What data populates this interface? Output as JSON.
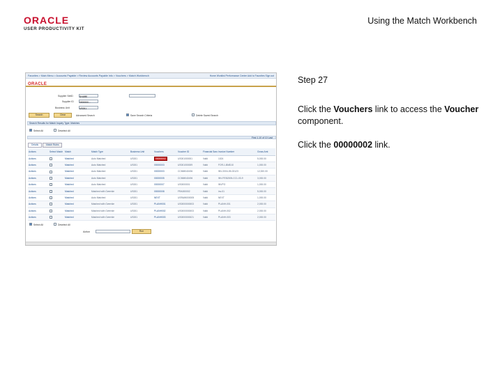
{
  "header": {
    "logo_brand": "ORACLE",
    "logo_subtitle": "USER PRODUCTIVITY KIT",
    "title": "Using the Match Workbench"
  },
  "instructions": {
    "step": "Step 27",
    "line1_pre": "Click the ",
    "line1_bold1": "Vouchers",
    "line1_mid": " link to access the ",
    "line1_bold2": "Voucher",
    "line1_post": " component.",
    "line2_pre": "Click the ",
    "line2_bold": "00000002",
    "line2_post": " link."
  },
  "screenshot": {
    "crumbs": "Favorites > Main Menu > Accounts Payable > Review Accounts Payable Info > Vouchers > Match Workbench",
    "navlinks": "Home   Worklist   Performance Center   Add to Favorites   Sign out",
    "oracle": "ORACLE",
    "fields": {
      "supplier_setid_label": "Supplier SetID",
      "supplier_setid_value": "SHARE",
      "supplier_id_label": "Supplier ID",
      "supplier_id_value": "0000000...",
      "match_rule_label": "Business Unit",
      "match_rule_value": "US001"
    },
    "buttons": {
      "search": "Search",
      "clear": "Clear",
      "continue": "Continue",
      "run": "Run"
    },
    "options": {
      "advanced_search": "Advanced Search",
      "save_search_criteria": "Save Search Criteria",
      "delete_saved_search": "Delete Saved Search"
    },
    "section_title": "Search Results for Match Inquiry Type: Matches",
    "select_all": "Select All",
    "deselect_all": "Deselect All",
    "tabs": [
      "Details",
      "Match Rules"
    ],
    "pager": "First  1-10 of 10  Last",
    "columns": [
      "Actions",
      "Select Match",
      "Match",
      "Match Type",
      "Business Unit",
      "Vouchers",
      "Voucher ID",
      "Financial Sanctions Status",
      "Invoice Number",
      "Gross Amt"
    ],
    "rows": [
      [
        "Actions",
        "",
        "Matched",
        "Auto Matched",
        "US001",
        "00000002",
        "US001000001",
        "Valid",
        "1024",
        "5,000.00"
      ],
      [
        "Actions",
        "",
        "Matched",
        "Auto Matched",
        "US001",
        "00000003",
        "US001000009",
        "Valid",
        "FOR-1-BMD10",
        "1,000.00"
      ],
      [
        "Actions",
        "",
        "Matched",
        "Auto Matched",
        "US001",
        "00000003",
        "CCMM040494",
        "Valid",
        "INV-2004-05-00123",
        "12,000.00"
      ],
      [
        "Actions",
        "",
        "Matched",
        "Auto Matched",
        "US001",
        "00000005",
        "CCMM040494",
        "Valid",
        "INV-FEB2005-CC1-03-9",
        "3,000.00"
      ],
      [
        "Actions",
        "",
        "Matched",
        "Auto Matched",
        "US001",
        "00000007",
        "US0000001",
        "Valid",
        "INVPO",
        "1,000.00"
      ],
      [
        "Actions",
        "",
        "Matched",
        "Matched with Override",
        "US001",
        "00000008",
        "FRA000002",
        "Valid",
        "inv-01",
        "5,000.00"
      ],
      [
        "Actions",
        "",
        "Matched",
        "Auto Matched",
        "US001",
        "NEXT",
        "USRAW000005",
        "Valid",
        "NEXT",
        "1,000.00"
      ],
      [
        "Actions",
        "",
        "Matched",
        "Matched with Override",
        "US001",
        "PLANH001",
        "US0000000003",
        "Valid",
        "PLANH-001",
        "2,000.00"
      ],
      [
        "Actions",
        "",
        "Matched",
        "Matched with Override",
        "US001",
        "PLANH002",
        "US0000000003",
        "Valid",
        "PLANH-002",
        "2,000.00"
      ],
      [
        "Actions",
        "",
        "Matched",
        "Matched with Override",
        "US001",
        "PLANH003",
        "US0000000021",
        "Valid",
        "PLANH-003",
        "2,000.00"
      ]
    ],
    "footer_action": "Action"
  }
}
